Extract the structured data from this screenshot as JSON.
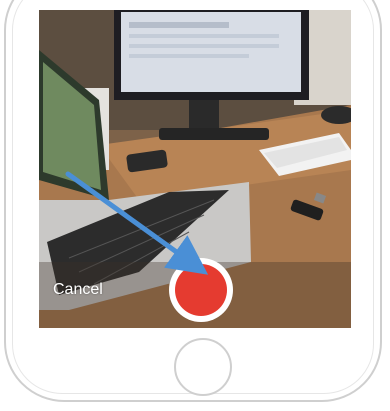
{
  "camera": {
    "cancel_label": "Cancel",
    "record_button": {
      "state": "stop-ready",
      "color": "#e53b30"
    }
  },
  "annotation": {
    "arrow_color": "#4a8fd6"
  },
  "colors": {
    "screen_background": "#8b6a4c",
    "device_frame": "#cfcfcf"
  }
}
